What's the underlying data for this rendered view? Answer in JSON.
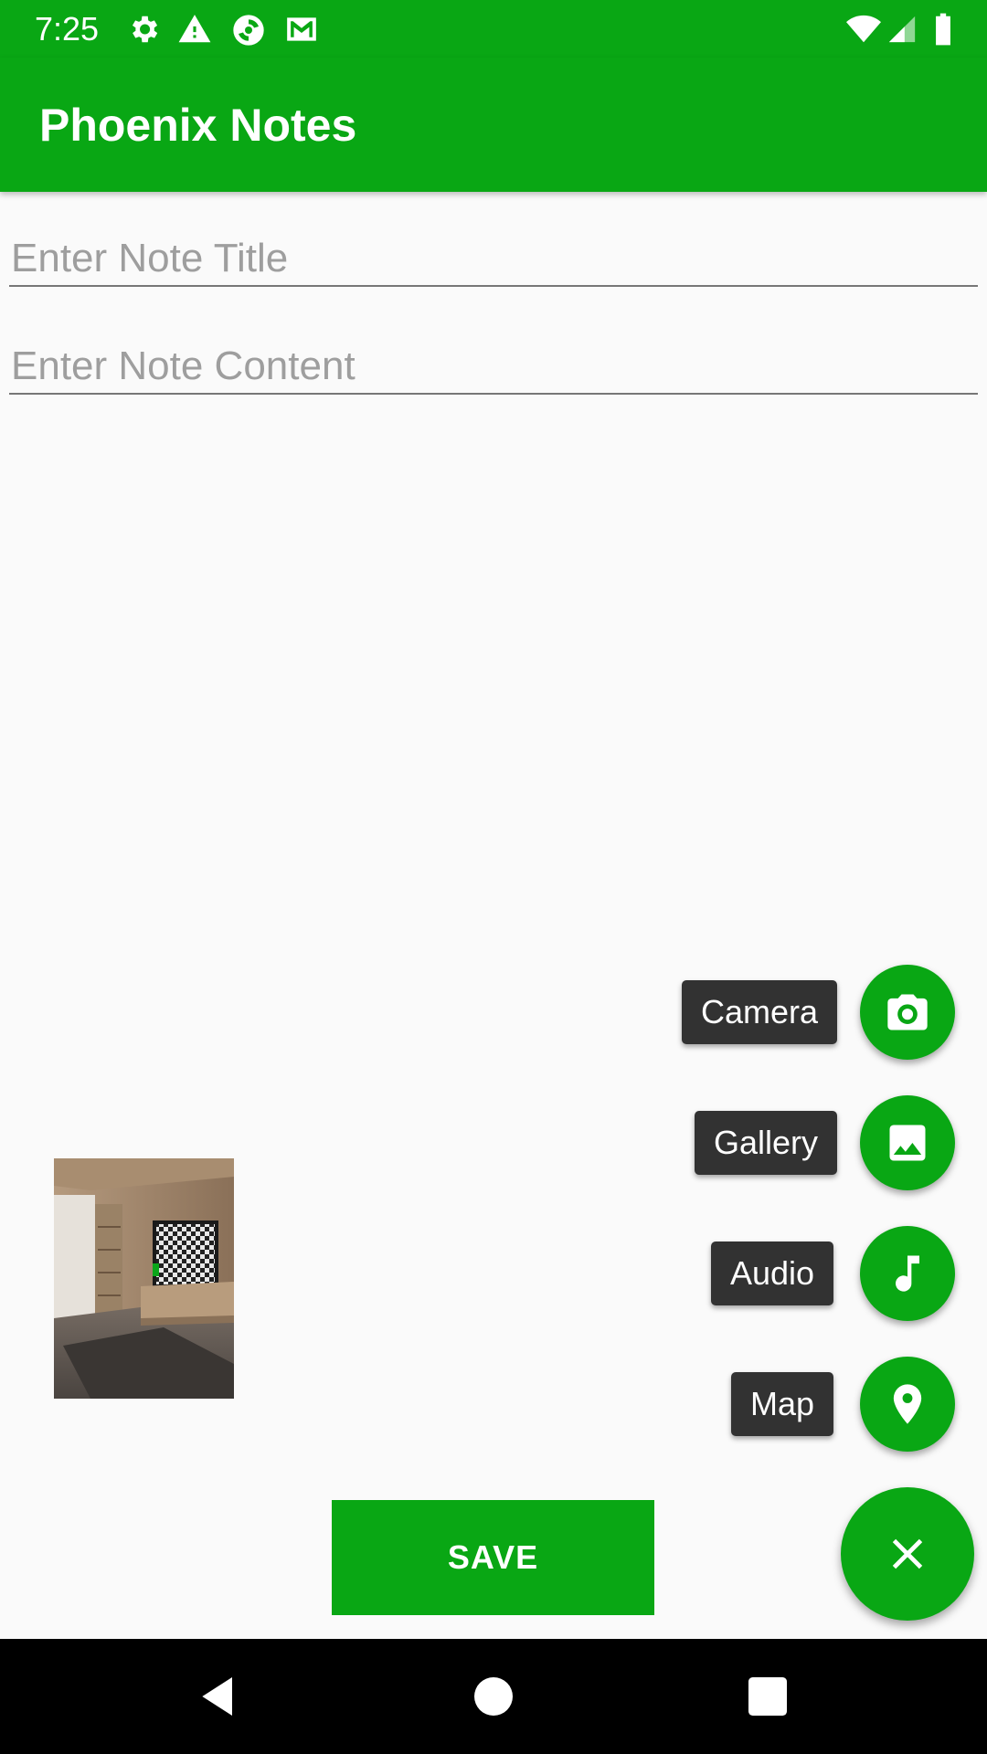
{
  "status_bar": {
    "time": "7:25",
    "left_icons": [
      "settings-icon",
      "warning-icon",
      "sync-app-icon",
      "gmail-icon"
    ],
    "right_icons": [
      "wifi-icon",
      "cell-signal-icon",
      "battery-icon"
    ]
  },
  "app_bar": {
    "title": "Phoenix Notes"
  },
  "form": {
    "title_value": "",
    "title_placeholder": "Enter Note Title",
    "content_value": "",
    "content_placeholder": "Enter Note Content"
  },
  "attachment": {
    "icon": "image-thumbnail"
  },
  "fab_menu": {
    "items": [
      {
        "label": "Camera",
        "icon": "camera-icon"
      },
      {
        "label": "Gallery",
        "icon": "image-icon"
      },
      {
        "label": "Audio",
        "icon": "music-note-icon"
      },
      {
        "label": "Map",
        "icon": "location-pin-icon"
      }
    ],
    "main_icon": "close-icon"
  },
  "save_button": {
    "label": "SAVE"
  },
  "nav_bar": {
    "buttons": [
      "back-icon",
      "home-icon",
      "recents-icon"
    ]
  },
  "colors": {
    "primary": "#09a714",
    "label_bg": "#323232",
    "background": "#fafafa"
  }
}
